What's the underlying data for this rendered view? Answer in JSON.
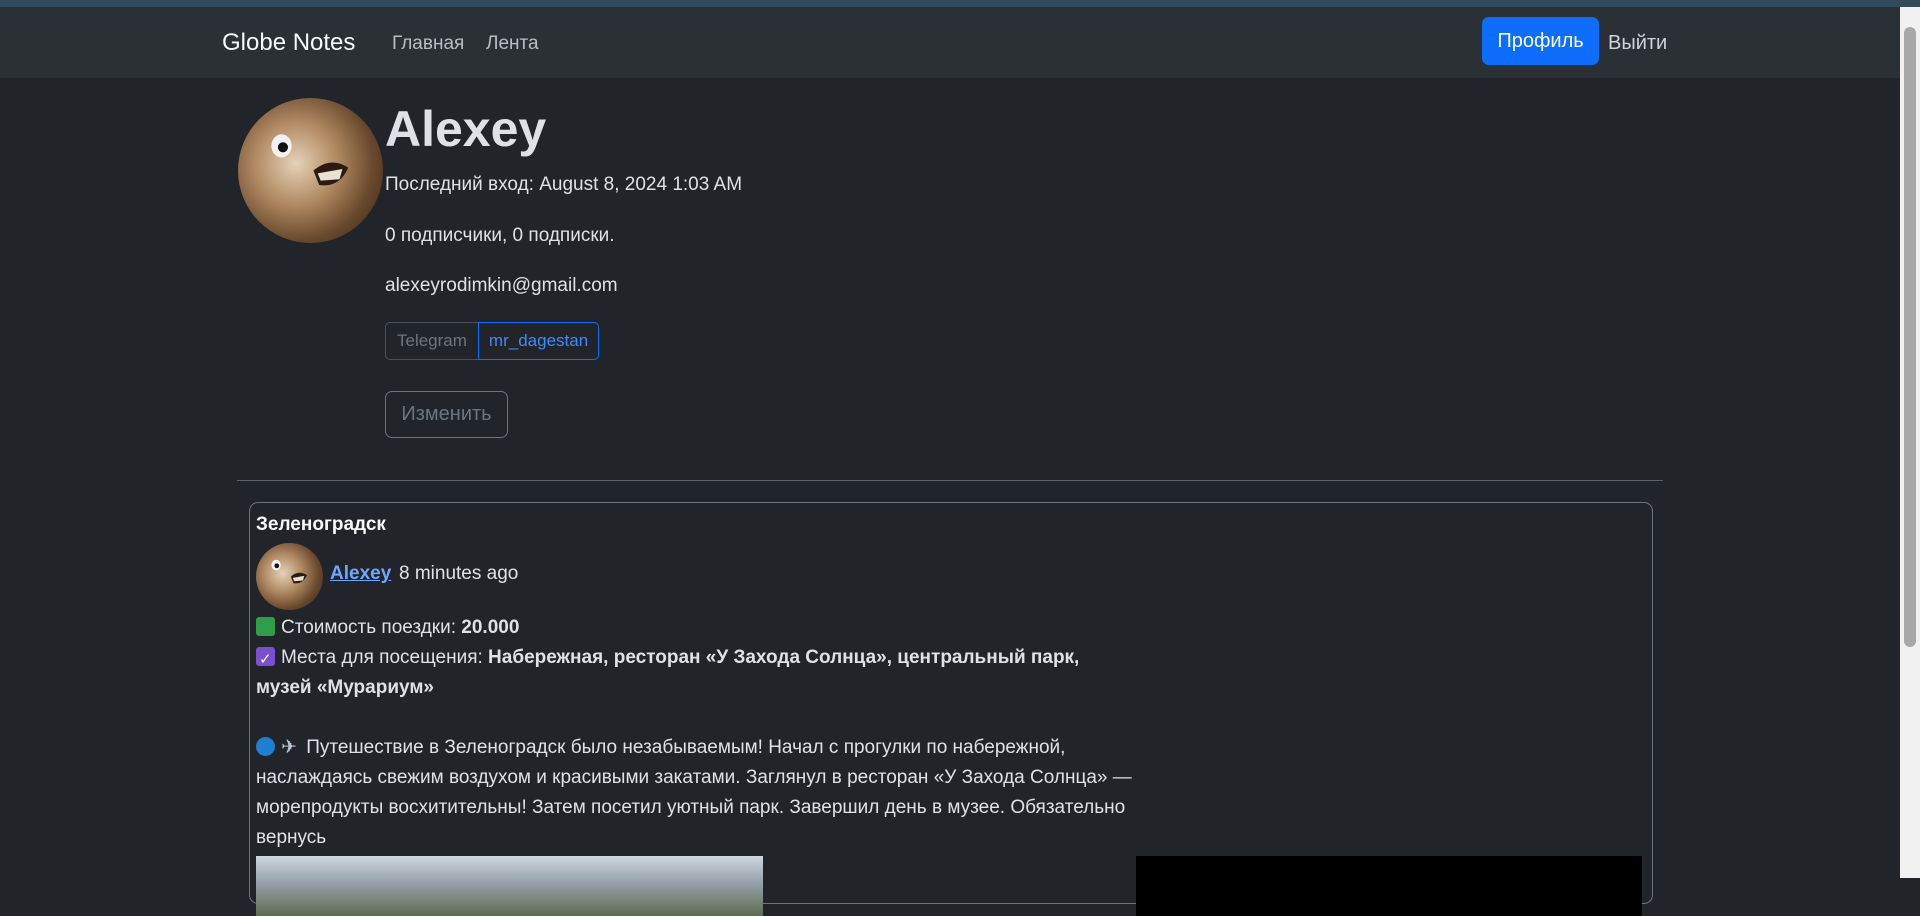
{
  "navbar": {
    "brand": "Globe Notes",
    "links": {
      "home": "Главная",
      "feed": "Лента"
    },
    "profile_button": "Профиль",
    "logout": "Выйти"
  },
  "profile": {
    "name": "Alexey",
    "last_login": "Последний вход: August 8, 2024 1:03 AM",
    "follow_stats": "0 подписчики, 0 подписки.",
    "email": "alexeyrodimkin@gmail.com",
    "telegram_label": "Telegram",
    "telegram_handle": "mr_dagestan",
    "edit_button": "Изменить"
  },
  "post": {
    "title": "Зеленоградск",
    "author": "Alexey ",
    "time_ago": "8 minutes ago",
    "cost_label": "Стоимость поездки: ",
    "cost_value": "20.000",
    "places_label": "Места для посещения: ",
    "places_value": "Набережная, ресторан «У Захода Солнца», центральный парк, музей «Мурариум»",
    "description": "Путешествие в Зеленоградск было незабываемым! Начал с прогулки по набережной, наслаждаясь свежим воздухом и красивыми закатами. Заглянул в ресторан «У Захода Солнца» — морепродукты восхитительны! Затем посетил уютный парк. Завершил день в музее. Обязательно вернусь"
  },
  "icons": {
    "cash": "cash-icon",
    "check": "check-mark-icon",
    "wave": "wave-icon",
    "plane": "airplane-icon"
  },
  "colors": {
    "background": "#212529",
    "navbar": "#2b3035",
    "primary": "#0d6efd",
    "link": "#6ea8fe"
  }
}
